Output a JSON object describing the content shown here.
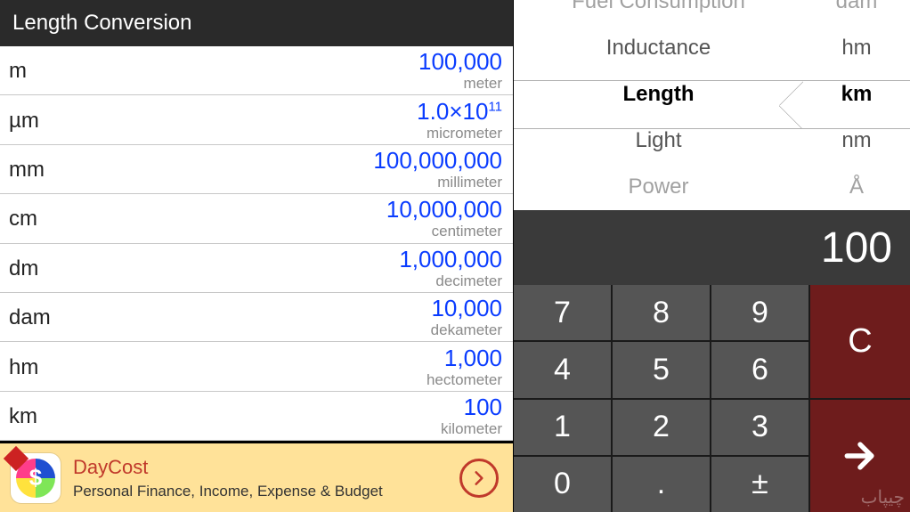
{
  "header": {
    "title": "Length Conversion"
  },
  "conversions": [
    {
      "abbr": "m",
      "value_html": "100,000",
      "name": "meter"
    },
    {
      "abbr": "µm",
      "value_html": "1.0×10<sup>11</sup>",
      "name": "micrometer"
    },
    {
      "abbr": "mm",
      "value_html": "100,000,000",
      "name": "millimeter"
    },
    {
      "abbr": "cm",
      "value_html": "10,000,000",
      "name": "centimeter"
    },
    {
      "abbr": "dm",
      "value_html": "1,000,000",
      "name": "decimeter"
    },
    {
      "abbr": "dam",
      "value_html": "10,000",
      "name": "dekameter"
    },
    {
      "abbr": "hm",
      "value_html": "1,000",
      "name": "hectometer"
    },
    {
      "abbr": "km",
      "value_html": "100",
      "name": "kilometer"
    }
  ],
  "ad": {
    "title": "DayCost",
    "subtitle": "Personal Finance, Income, Expense & Budget",
    "icon_symbol": "$"
  },
  "picker": {
    "categories": [
      "Fuel Consumption",
      "Inductance",
      "Length",
      "Light",
      "Power"
    ],
    "selected_category_index": 2,
    "units": [
      "dam",
      "hm",
      "km",
      "nm",
      "Å"
    ],
    "selected_unit_index": 2
  },
  "display": {
    "value": "100"
  },
  "keypad": {
    "keys": [
      "7",
      "8",
      "9",
      "4",
      "5",
      "6",
      "1",
      "2",
      "3",
      "0",
      ".",
      "±"
    ],
    "clear": "C"
  },
  "watermark": "چیپاب"
}
